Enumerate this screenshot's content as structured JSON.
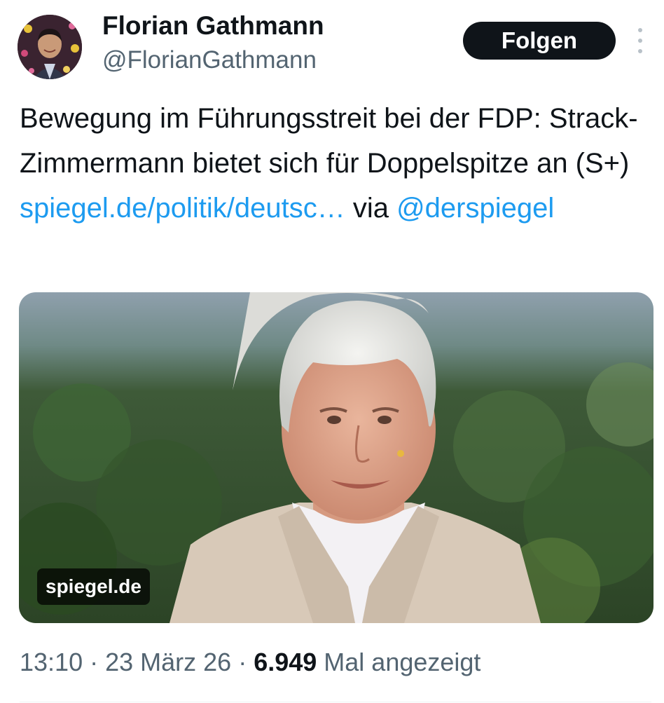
{
  "author": {
    "display_name": "Florian Gathmann",
    "handle": "@FlorianGathmann"
  },
  "actions": {
    "follow_label": "Folgen",
    "more_icon": "more-vertical-icon"
  },
  "tweet": {
    "text": "Bewegung im Führungsstreit bei der FDP: Strack-Zimmermann bietet sich für Doppelspitze an (S+) ",
    "link_text": "spiegel.de/politik/deutsc…",
    "via": " via ",
    "mention": "@derspiegel"
  },
  "media": {
    "source_label": "spiegel.de"
  },
  "meta": {
    "time": "13:10",
    "separator": " · ",
    "date": "23 März 26",
    "views_count": "6.949",
    "views_label": " Mal angezeigt"
  },
  "colors": {
    "link": "#1d9bf0",
    "secondary_text": "#536471",
    "follow_bg": "#0f1419"
  }
}
